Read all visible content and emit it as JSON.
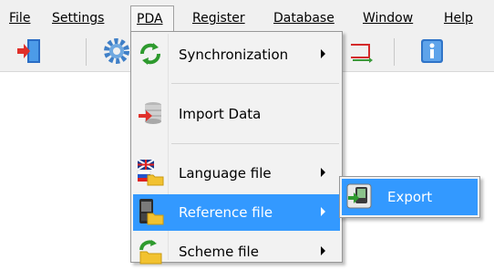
{
  "menubar": {
    "items": [
      {
        "label": "File"
      },
      {
        "label": "Settings"
      },
      {
        "label": "PDA"
      },
      {
        "label": "Register"
      },
      {
        "label": "Database"
      },
      {
        "label": "Window"
      },
      {
        "label": "Help"
      }
    ]
  },
  "toolbar": {
    "icons": [
      "exit-door-icon",
      "gear-icon",
      "transfer-icon",
      "info-icon"
    ]
  },
  "pda_menu": {
    "items": [
      {
        "label": "Synchronization",
        "icon": "sync-arrows-icon",
        "has_submenu": true
      },
      {
        "label": "Import Data",
        "icon": "database-import-icon",
        "has_submenu": false
      },
      {
        "label": "Language file",
        "icon": "language-flags-icon",
        "has_submenu": true
      },
      {
        "label": "Reference file",
        "icon": "reference-file-icon",
        "has_submenu": true,
        "highlighted": true
      },
      {
        "label": "Scheme file",
        "icon": "scheme-file-icon",
        "has_submenu": true
      }
    ]
  },
  "reference_submenu": {
    "items": [
      {
        "label": "Export",
        "icon": "export-icon",
        "highlighted": true
      }
    ]
  },
  "colors": {
    "highlight": "#3399ff",
    "menu_bg": "#f2f2f2",
    "bar_bg": "#f0f0f0"
  }
}
